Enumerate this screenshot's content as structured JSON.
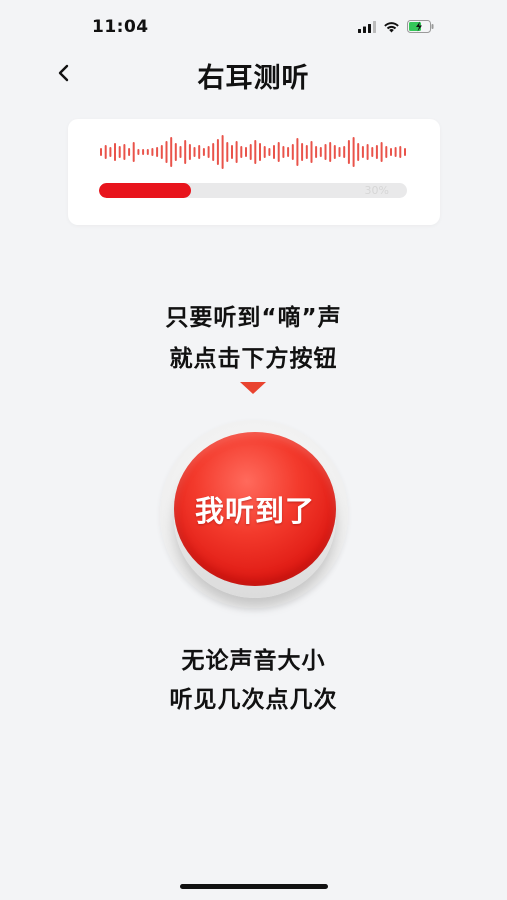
{
  "status": {
    "time": "11:04"
  },
  "nav": {
    "title": "右耳测听"
  },
  "test": {
    "progress_label": "30%",
    "progress_value": 0.3
  },
  "instructions": {
    "line1": "只要听到“嘀”声",
    "line2": "就点击下方按钮"
  },
  "button": {
    "label": "我听到了"
  },
  "hint": {
    "line1": "无论声音大小",
    "line2": "听见几次点几次"
  },
  "colors": {
    "accent": "#e8141c",
    "background": "#f3f4f6",
    "waveform": "#e9534a"
  }
}
